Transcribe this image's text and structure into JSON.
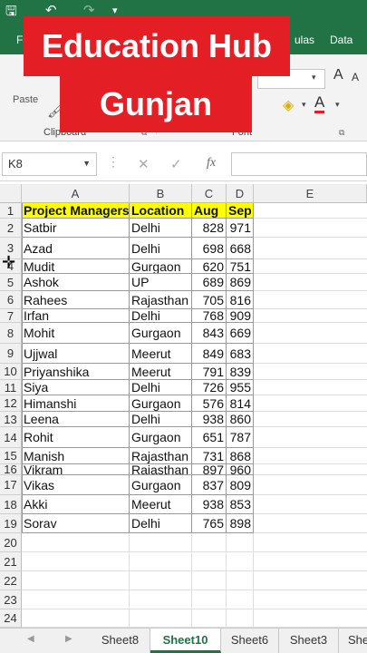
{
  "app": {
    "qat": {
      "save_icon": "save-icon",
      "undo_icon": "undo-icon",
      "redo_icon": "redo-icon",
      "customize_icon": "chevron-down-icon"
    },
    "ribbon_tabs": [
      "F",
      "ulas",
      "Data"
    ],
    "ribbon_groups": [
      "Paste",
      "Clipboard",
      "Font"
    ]
  },
  "banner": {
    "line1": "Education Hub by",
    "line2": "Gunjan Gaur",
    "color": "#e41e25"
  },
  "formula_bar": {
    "name_box": "K8",
    "cancel_glyph": "✕",
    "enter_glyph": "✓",
    "fx_label": "fx",
    "formula": ""
  },
  "grid": {
    "columns": [
      "A",
      "B",
      "C",
      "D",
      "E"
    ],
    "row_numbers": [
      "1",
      "2",
      "3",
      "4",
      "5",
      "6",
      "7",
      "8",
      "9",
      "10",
      "11",
      "12",
      "13",
      "14",
      "15",
      "16",
      "17",
      "18",
      "19",
      "20",
      "21",
      "22",
      "23",
      "24"
    ],
    "header_row": [
      "Project Managers",
      "Location",
      "Aug",
      "Sep"
    ],
    "rows": [
      [
        "Satbir",
        "Delhi",
        "828",
        "971"
      ],
      [
        "Azad",
        "Delhi",
        "698",
        "668"
      ],
      [
        "Mudit",
        "Gurgaon",
        "620",
        "751"
      ],
      [
        "Ashok",
        "UP",
        "689",
        "869"
      ],
      [
        "Rahees",
        "Rajasthan",
        "705",
        "816"
      ],
      [
        "Irfan",
        "Delhi",
        "768",
        "909"
      ],
      [
        "Mohit",
        "Gurgaon",
        "843",
        "669"
      ],
      [
        "Ujjwal",
        "Meerut",
        "849",
        "683"
      ],
      [
        "Priyanshika",
        "Meerut",
        "791",
        "839"
      ],
      [
        "Siya",
        "Delhi",
        "726",
        "955"
      ],
      [
        "Himanshi",
        "Gurgaon",
        "576",
        "814"
      ],
      [
        "Leena",
        "Delhi",
        "938",
        "860"
      ],
      [
        "Rohit",
        "Gurgaon",
        "651",
        "787"
      ],
      [
        "Manish",
        "Rajasthan",
        "731",
        "868"
      ],
      [
        "Vikram",
        "Rajasthan",
        "897",
        "960"
      ],
      [
        "Vikas",
        "Gurgaon",
        "837",
        "809"
      ],
      [
        "Akki",
        "Meerut",
        "938",
        "853"
      ],
      [
        "Sorav",
        "Delhi",
        "765",
        "898"
      ]
    ],
    "header_fill": "#ffff00"
  },
  "sheet_tabs": {
    "tabs": [
      "Sheet8",
      "Sheet10",
      "Sheet6",
      "Sheet3",
      "She"
    ],
    "active": "Sheet10",
    "accent": "#217346"
  }
}
